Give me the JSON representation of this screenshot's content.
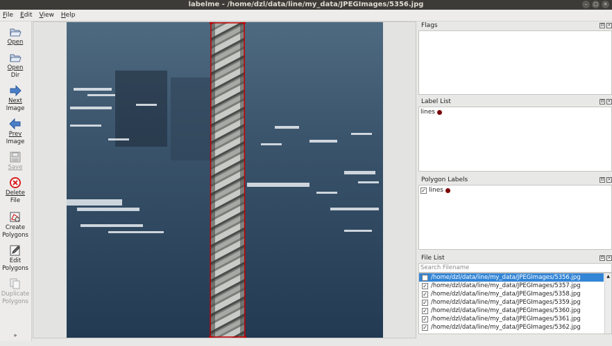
{
  "window": {
    "title": "labelme - /home/dzl/data/line/my_data/JPEGImages/5356.jpg",
    "buttons": [
      "–",
      "□",
      "×"
    ]
  },
  "menu": [
    {
      "label": "File",
      "key": "F",
      "rest": "ile"
    },
    {
      "label": "Edit",
      "key": "E",
      "rest": "dit"
    },
    {
      "label": "View",
      "key": "V",
      "rest": "iew"
    },
    {
      "label": "Help",
      "key": "H",
      "rest": "elp"
    }
  ],
  "toolbar": {
    "open": {
      "line1": "Open",
      "icon": "folder-open-icon"
    },
    "open_dir": {
      "line1": "Open",
      "line2": "Dir",
      "icon": "folder-open-icon"
    },
    "next_image": {
      "line1": "Next",
      "line2": "Image",
      "icon": "arrow-right-icon"
    },
    "prev_image": {
      "line1": "Prev",
      "line2": "Image",
      "icon": "arrow-left-icon"
    },
    "save": {
      "line1": "Save",
      "icon": "save-icon",
      "enabled": false
    },
    "delete_file": {
      "line1": "Delete",
      "line2": "File",
      "icon": "delete-icon"
    },
    "create_polygons": {
      "line1": "Create",
      "line2": "Polygons",
      "icon": "create-polygon-icon"
    },
    "edit_polygons": {
      "line1": "Edit",
      "line2": "Polygons",
      "icon": "edit-icon"
    },
    "duplicate_polygons": {
      "line1": "Duplicate",
      "line2": "Polygons",
      "icon": "copy-icon",
      "enabled": false
    },
    "more": "»"
  },
  "docks": {
    "flags": {
      "title": "Flags"
    },
    "label_list": {
      "title": "Label List",
      "items": [
        {
          "label": "lines",
          "color": "#7a0000"
        }
      ]
    },
    "polygon_labels": {
      "title": "Polygon Labels",
      "items": [
        {
          "label": "lines",
          "checked": true,
          "color": "#7a0000"
        }
      ]
    },
    "file_list": {
      "title": "File List",
      "search_placeholder": "Search Filename",
      "files": [
        "/home/dzl/data/line/my_data/JPEGImages/5356.jpg",
        "/home/dzl/data/line/my_data/JPEGImages/5357.jpg",
        "/home/dzl/data/line/my_data/JPEGImages/5358.jpg",
        "/home/dzl/data/line/my_data/JPEGImages/5359.jpg",
        "/home/dzl/data/line/my_data/JPEGImages/5360.jpg",
        "/home/dzl/data/line/my_data/JPEGImages/5361.jpg",
        "/home/dzl/data/line/my_data/JPEGImages/5362.jpg"
      ],
      "selected_index": 0
    }
  },
  "colors": {
    "polygon_outline": "#c40000",
    "selection": "#3385d6",
    "titlebar": "#3c3b37"
  }
}
